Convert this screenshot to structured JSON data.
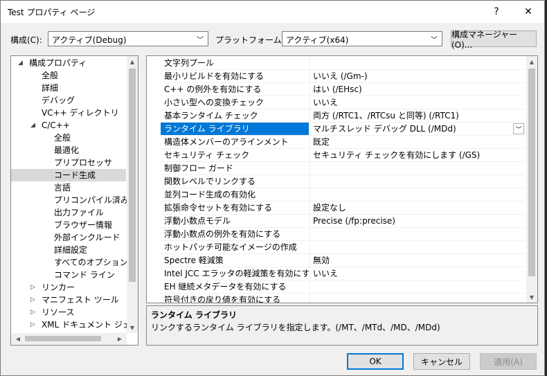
{
  "window": {
    "title": "Test プロパティ ページ",
    "help_label": "?",
    "close_label": "✕"
  },
  "top": {
    "config_label": "構成(C):",
    "config_value": "アクティブ(Debug)",
    "platform_label": "プラットフォーム(P):",
    "platform_value": "アクティブ(x64)",
    "config_manager_label": "構成マネージャー(O)..."
  },
  "tree": {
    "items": [
      {
        "label": "構成プロパティ",
        "expander": "◢"
      },
      {
        "label": "全般",
        "expander": ""
      },
      {
        "label": "詳細",
        "expander": ""
      },
      {
        "label": "デバッグ",
        "expander": ""
      },
      {
        "label": "VC++ ディレクトリ",
        "expander": ""
      },
      {
        "label": "C/C++",
        "expander": "◢"
      },
      {
        "label": "全般",
        "expander": ""
      },
      {
        "label": "最適化",
        "expander": ""
      },
      {
        "label": "プリプロセッサ",
        "expander": ""
      },
      {
        "label": "コード生成",
        "expander": ""
      },
      {
        "label": "言語",
        "expander": ""
      },
      {
        "label": "プリコンパイル済みヘッ",
        "expander": ""
      },
      {
        "label": "出力ファイル",
        "expander": ""
      },
      {
        "label": "ブラウザー情報",
        "expander": ""
      },
      {
        "label": "外部インクルード",
        "expander": ""
      },
      {
        "label": "詳細設定",
        "expander": ""
      },
      {
        "label": "すべてのオプション",
        "expander": ""
      },
      {
        "label": "コマンド ライン",
        "expander": ""
      },
      {
        "label": "リンカー",
        "expander": "▷"
      },
      {
        "label": "マニフェスト ツール",
        "expander": "▷"
      },
      {
        "label": "リソース",
        "expander": "▷"
      },
      {
        "label": "XML ドキュメント ジェネレー",
        "expander": "▷"
      }
    ]
  },
  "properties": {
    "rows": [
      {
        "name": "文字列プール",
        "value": ""
      },
      {
        "name": "最小リビルドを有効にする",
        "value": "いいえ (/Gm-)"
      },
      {
        "name": "C++ の例外を有効にする",
        "value": "はい (/EHsc)"
      },
      {
        "name": "小さい型への変換チェック",
        "value": "いいえ"
      },
      {
        "name": "基本ランタイム チェック",
        "value": "両方 (/RTC1、/RTCsu と同等) (/RTC1)"
      },
      {
        "name": "ランタイム ライブラリ",
        "value": "マルチスレッド デバッグ DLL (/MDd)"
      },
      {
        "name": "構造体メンバーのアラインメント",
        "value": "既定"
      },
      {
        "name": "セキュリティ チェック",
        "value": "セキュリティ チェックを有効にします (/GS)"
      },
      {
        "name": "制御フロー ガード",
        "value": ""
      },
      {
        "name": "関数レベルでリンクする",
        "value": ""
      },
      {
        "name": "並列コード生成の有効化",
        "value": ""
      },
      {
        "name": "拡張命令セットを有効にする",
        "value": "設定なし"
      },
      {
        "name": "浮動小数点モデル",
        "value": "Precise (/fp:precise)"
      },
      {
        "name": "浮動小数点の例外を有効にする",
        "value": ""
      },
      {
        "name": "ホットパッチ可能なイメージの作成",
        "value": ""
      },
      {
        "name": "Spectre 軽減策",
        "value": "無効"
      },
      {
        "name": "Intel JCC エラッタの軽減策を有効にする",
        "value": "いいえ"
      },
      {
        "name": "EH 継続メタデータを有効にする",
        "value": ""
      },
      {
        "name": "符号付きの戻り値を有効にする",
        "value": ""
      }
    ]
  },
  "description": {
    "title": "ランタイム ライブラリ",
    "text": "リンクするランタイム ライブラリを指定します。(/MT、/MTd、/MD、/MDd)"
  },
  "buttons": {
    "ok": "OK",
    "cancel": "キャンセル",
    "apply": "適用(A)"
  },
  "colors": {
    "selection": "#0078d7",
    "tree_selection": "#cce8ff"
  }
}
